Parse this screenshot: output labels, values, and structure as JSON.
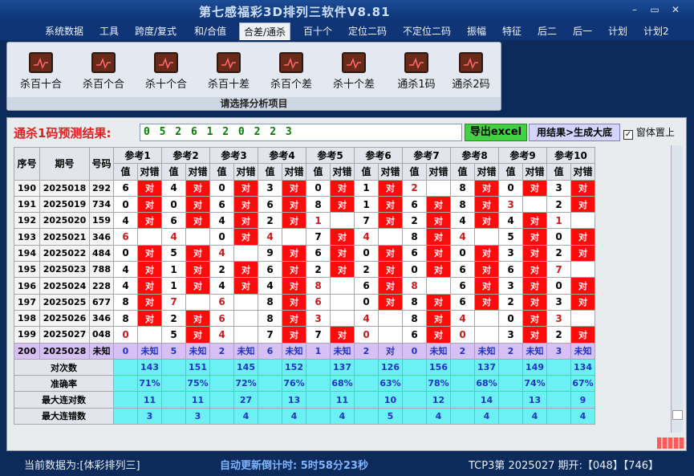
{
  "app": {
    "title": "第七感福彩3D排列三软件V8.81"
  },
  "window": {
    "minimize_glyph": "–",
    "restore_glyph": "▭",
    "close_glyph": "✕"
  },
  "menu": [
    "系统数据",
    "工具",
    "跨度/复式",
    "和/合值",
    "合差/通杀",
    "百十个",
    "定位二码",
    "不定位二码",
    "振幅",
    "特征",
    "后二",
    "后一",
    "计划",
    "计划2"
  ],
  "menu_active": "合差/通杀",
  "ribbon": {
    "buttons": [
      "杀百十合",
      "杀百个合",
      "杀十个合",
      "杀百十差",
      "杀百个差",
      "杀十个差",
      "通杀1码",
      "通杀2码"
    ],
    "caption": "请选择分析项目",
    "icon": "line-chart-icon"
  },
  "prediction": {
    "label": "通杀1码预测结果:",
    "value": "0 5 2 6 1 2 0 2 2 3",
    "export_button": "导出excel",
    "generate_button": "用结果>生成大底",
    "topmost_checkbox": "窗体置上",
    "topmost_checked": true
  },
  "table": {
    "head": {
      "seq": "序号",
      "issue": "期号",
      "code": "号码",
      "val": "值",
      "okfail": "对错"
    },
    "refs": [
      "参考1",
      "参考2",
      "参考3",
      "参考4",
      "参考5",
      "参考6",
      "参考7",
      "参考8",
      "参考9",
      "参考10"
    ],
    "ok_text": "对",
    "rows": [
      {
        "seq": "190",
        "issue": "2025018",
        "code": "292",
        "cells": [
          [
            "6",
            "对"
          ],
          [
            "4",
            "对"
          ],
          [
            "0",
            "对"
          ],
          [
            "3",
            "对"
          ],
          [
            "0",
            "对"
          ],
          [
            "1",
            "对"
          ],
          [
            "2",
            ""
          ],
          [
            "8",
            "对"
          ],
          [
            "0",
            "对"
          ],
          [
            "3",
            "对"
          ]
        ]
      },
      {
        "seq": "191",
        "issue": "2025019",
        "code": "734",
        "cells": [
          [
            "0",
            "对"
          ],
          [
            "0",
            "对"
          ],
          [
            "6",
            "对"
          ],
          [
            "6",
            "对"
          ],
          [
            "8",
            "对"
          ],
          [
            "1",
            "对"
          ],
          [
            "6",
            "对"
          ],
          [
            "8",
            "对"
          ],
          [
            "3",
            ""
          ],
          [
            "2",
            "对"
          ]
        ]
      },
      {
        "seq": "192",
        "issue": "2025020",
        "code": "159",
        "cells": [
          [
            "4",
            "对"
          ],
          [
            "6",
            "对"
          ],
          [
            "4",
            "对"
          ],
          [
            "2",
            "对"
          ],
          [
            "1",
            ""
          ],
          [
            "7",
            "对"
          ],
          [
            "2",
            "对"
          ],
          [
            "4",
            "对"
          ],
          [
            "4",
            "对"
          ],
          [
            "1",
            ""
          ]
        ]
      },
      {
        "seq": "193",
        "issue": "2025021",
        "code": "346",
        "cells": [
          [
            "6",
            ""
          ],
          [
            "4",
            ""
          ],
          [
            "0",
            "对"
          ],
          [
            "4",
            ""
          ],
          [
            "7",
            "对"
          ],
          [
            "4",
            ""
          ],
          [
            "8",
            "对"
          ],
          [
            "4",
            ""
          ],
          [
            "5",
            "对"
          ],
          [
            "0",
            "对"
          ]
        ]
      },
      {
        "seq": "194",
        "issue": "2025022",
        "code": "484",
        "cells": [
          [
            "0",
            "对"
          ],
          [
            "5",
            "对"
          ],
          [
            "4",
            ""
          ],
          [
            "9",
            "对"
          ],
          [
            "6",
            "对"
          ],
          [
            "0",
            "对"
          ],
          [
            "6",
            "对"
          ],
          [
            "0",
            "对"
          ],
          [
            "3",
            "对"
          ],
          [
            "2",
            "对"
          ]
        ]
      },
      {
        "seq": "195",
        "issue": "2025023",
        "code": "788",
        "cells": [
          [
            "4",
            "对"
          ],
          [
            "1",
            "对"
          ],
          [
            "2",
            "对"
          ],
          [
            "6",
            "对"
          ],
          [
            "2",
            "对"
          ],
          [
            "2",
            "对"
          ],
          [
            "0",
            "对"
          ],
          [
            "6",
            "对"
          ],
          [
            "6",
            "对"
          ],
          [
            "7",
            ""
          ]
        ]
      },
      {
        "seq": "196",
        "issue": "2025024",
        "code": "228",
        "cells": [
          [
            "4",
            "对"
          ],
          [
            "1",
            "对"
          ],
          [
            "4",
            "对"
          ],
          [
            "4",
            "对"
          ],
          [
            "8",
            ""
          ],
          [
            "6",
            "对"
          ],
          [
            "8",
            ""
          ],
          [
            "6",
            "对"
          ],
          [
            "3",
            "对"
          ],
          [
            "0",
            "对"
          ]
        ]
      },
      {
        "seq": "197",
        "issue": "2025025",
        "code": "677",
        "cells": [
          [
            "8",
            "对"
          ],
          [
            "7",
            ""
          ],
          [
            "6",
            ""
          ],
          [
            "8",
            "对"
          ],
          [
            "6",
            ""
          ],
          [
            "0",
            "对"
          ],
          [
            "8",
            "对"
          ],
          [
            "6",
            "对"
          ],
          [
            "2",
            "对"
          ],
          [
            "3",
            "对"
          ]
        ]
      },
      {
        "seq": "198",
        "issue": "2025026",
        "code": "346",
        "cells": [
          [
            "8",
            "对"
          ],
          [
            "2",
            "对"
          ],
          [
            "6",
            ""
          ],
          [
            "8",
            "对"
          ],
          [
            "3",
            ""
          ],
          [
            "4",
            ""
          ],
          [
            "8",
            "对"
          ],
          [
            "4",
            ""
          ],
          [
            "0",
            "对"
          ],
          [
            "3",
            ""
          ]
        ]
      },
      {
        "seq": "199",
        "issue": "2025027",
        "code": "048",
        "cells": [
          [
            "0",
            ""
          ],
          [
            "5",
            "对"
          ],
          [
            "4",
            ""
          ],
          [
            "7",
            "对"
          ],
          [
            "7",
            "对"
          ],
          [
            "0",
            ""
          ],
          [
            "6",
            "对"
          ],
          [
            "0",
            ""
          ],
          [
            "3",
            "对"
          ],
          [
            "2",
            "对"
          ]
        ]
      },
      {
        "seq": "200",
        "issue": "2025028",
        "code": "未知",
        "cells": [
          [
            "0",
            "未知"
          ],
          [
            "5",
            "未知"
          ],
          [
            "2",
            "未知"
          ],
          [
            "6",
            "未知"
          ],
          [
            "1",
            "未知"
          ],
          [
            "2",
            "对"
          ],
          [
            "0",
            "未知"
          ],
          [
            "2",
            "未知"
          ],
          [
            "2",
            "未知"
          ],
          [
            "3",
            "未知"
          ]
        ]
      }
    ],
    "stats": [
      {
        "label": "对次数",
        "values": [
          "143",
          "151",
          "145",
          "152",
          "137",
          "126",
          "156",
          "137",
          "149",
          "134"
        ]
      },
      {
        "label": "准确率",
        "values": [
          "71%",
          "75%",
          "72%",
          "76%",
          "68%",
          "63%",
          "78%",
          "68%",
          "74%",
          "67%"
        ]
      },
      {
        "label": "最大连对数",
        "values": [
          "11",
          "11",
          "27",
          "13",
          "11",
          "10",
          "12",
          "14",
          "13",
          "9"
        ]
      },
      {
        "label": "最大连错数",
        "values": [
          "3",
          "3",
          "4",
          "4",
          "4",
          "5",
          "4",
          "4",
          "4",
          "4"
        ]
      }
    ]
  },
  "status": {
    "current_data": "当前数据为:[体彩排列三]",
    "countdown": "自动更新倒计时:  5时58分23秒",
    "last_draw": "TCP3第 2025027 期开:【048】【746】"
  },
  "colors": {
    "accent_red": "#ff0b0b",
    "stat_cyan": "#6bf0f4",
    "predict_row": "#d7c0f5",
    "title_blue": "#0f3577",
    "export_green": "#43d043"
  }
}
